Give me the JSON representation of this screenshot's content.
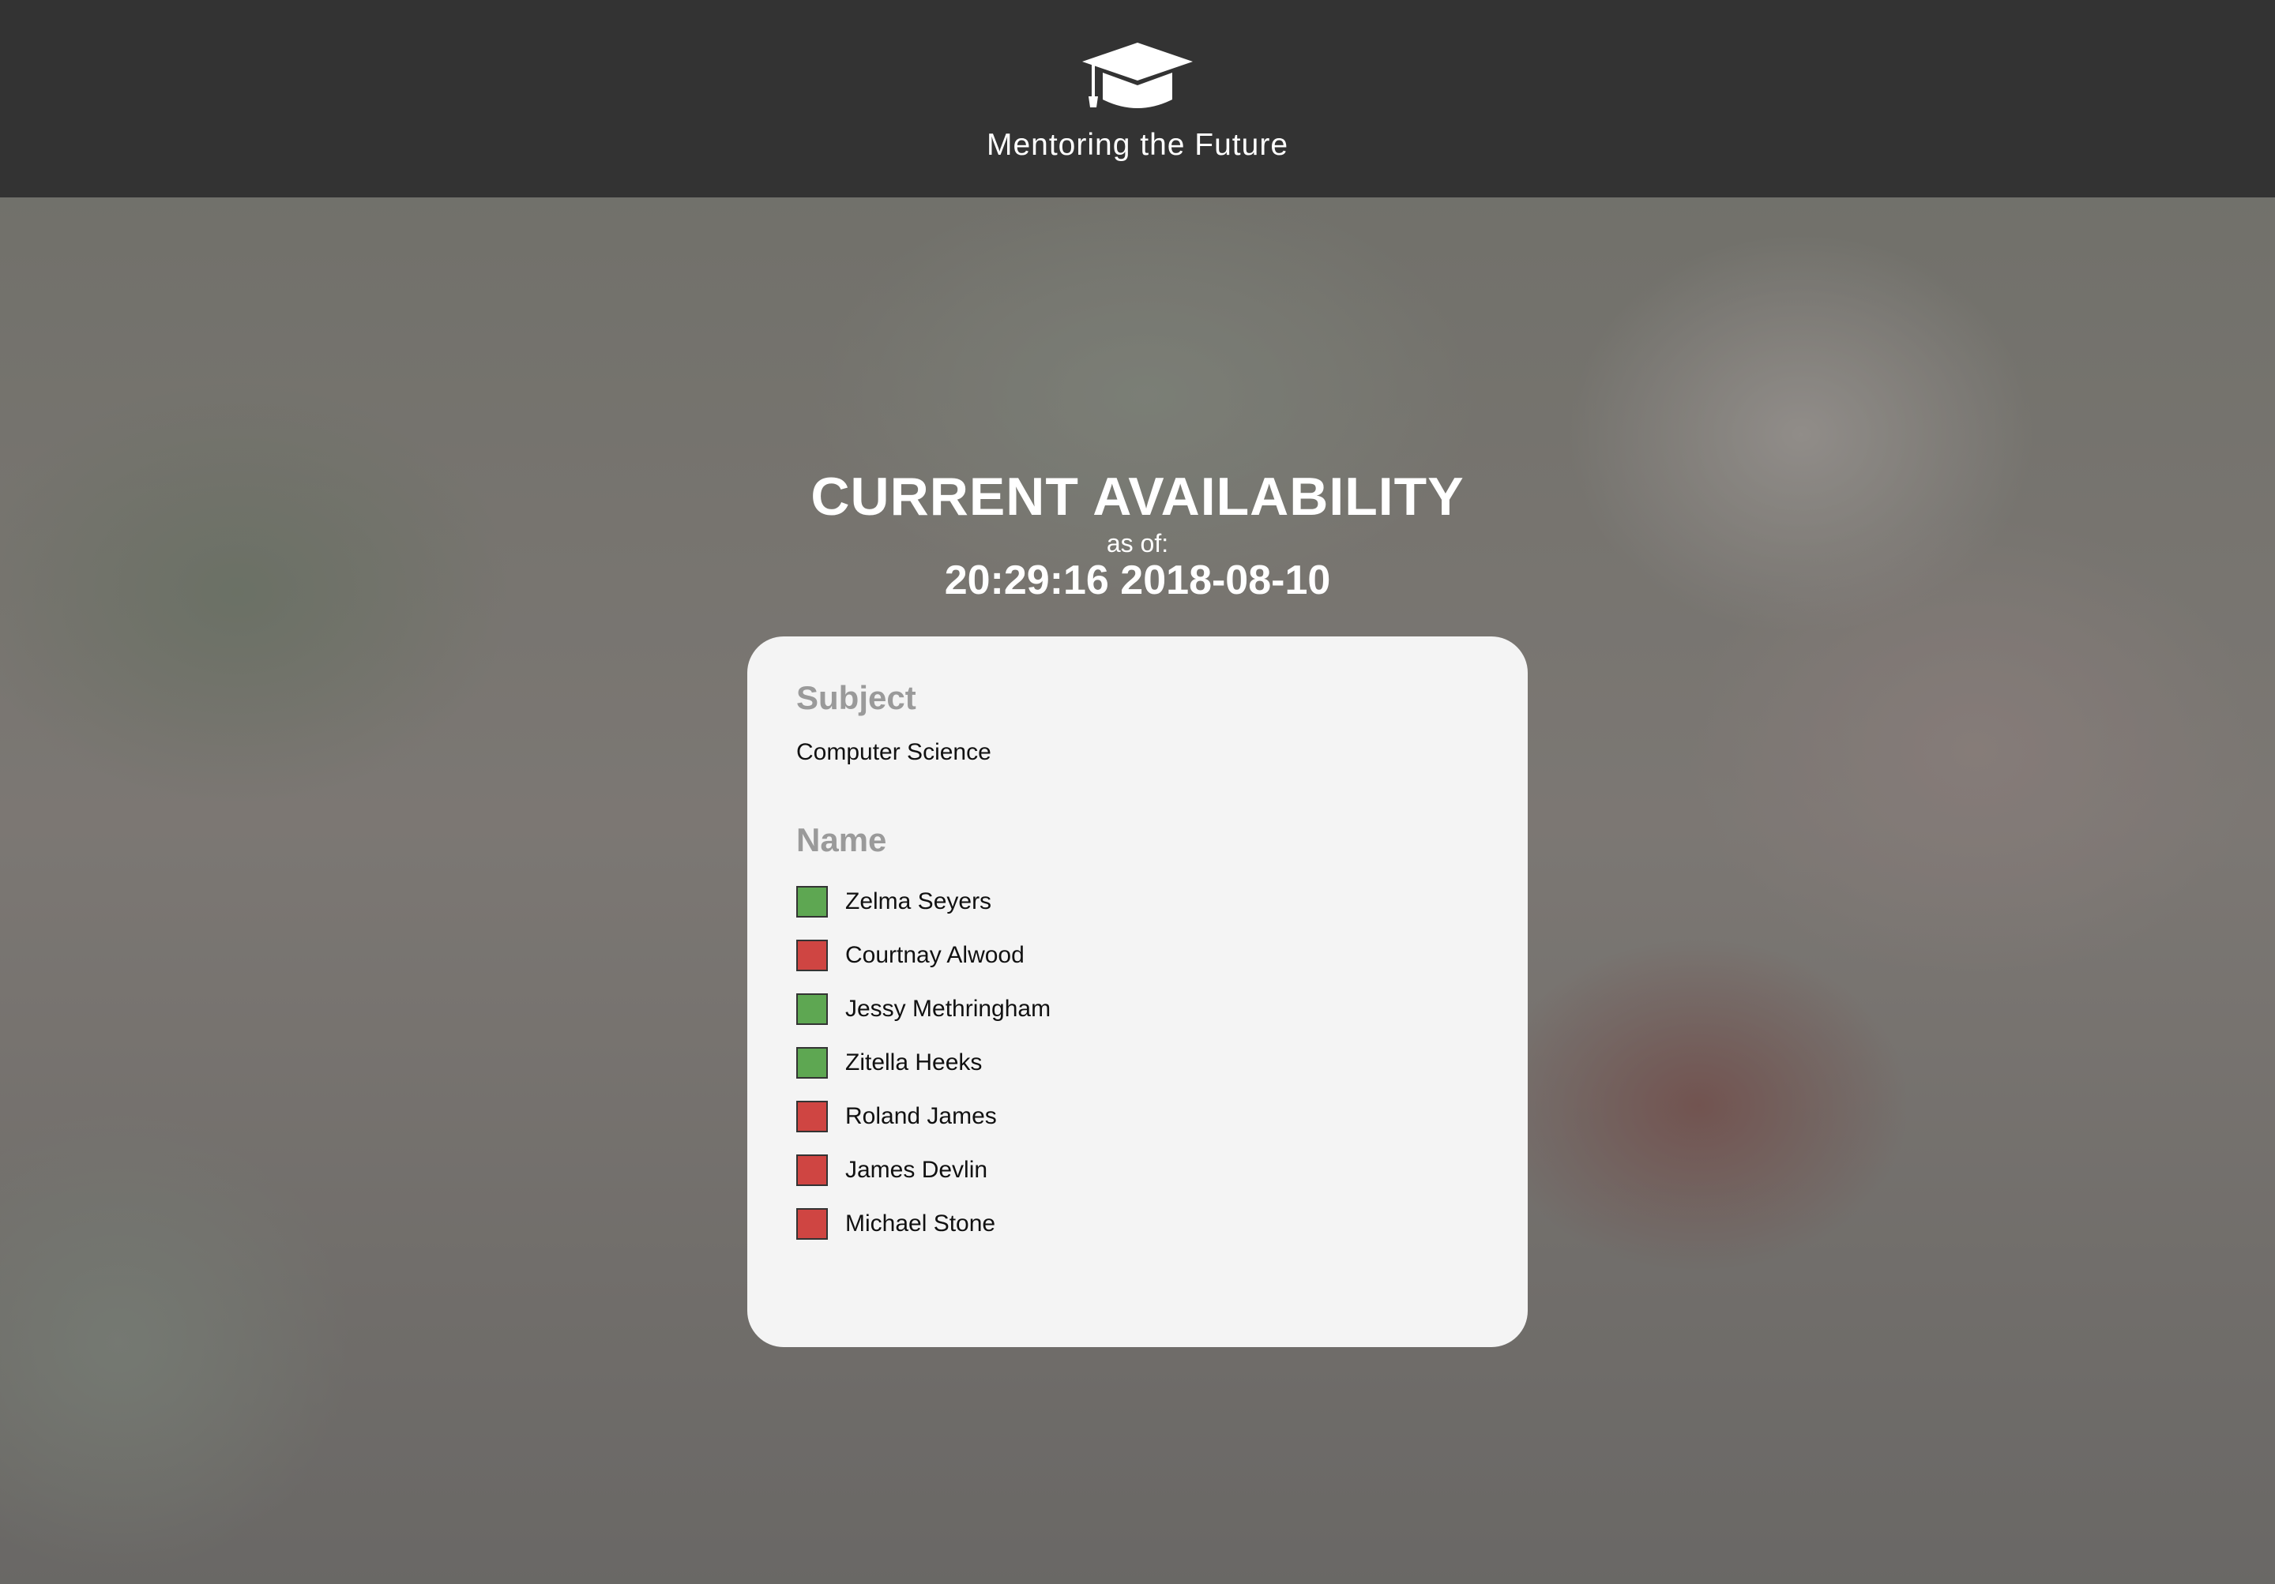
{
  "header": {
    "logo_icon": "graduation-cap-icon",
    "title": "Mentoring the Future"
  },
  "availability": {
    "heading": "CURRENT AVAILABILITY",
    "as_of_label": "as of:",
    "timestamp": "20:29:16 2018-08-10"
  },
  "card": {
    "subject_heading": "Subject",
    "subject_value": "Computer Science",
    "name_heading": "Name",
    "mentors": [
      {
        "name": "Zelma Seyers",
        "status": "available"
      },
      {
        "name": "Courtnay Alwood",
        "status": "unavailable"
      },
      {
        "name": "Jessy Methringham",
        "status": "available"
      },
      {
        "name": "Zitella Heeks",
        "status": "available"
      },
      {
        "name": "Roland James",
        "status": "unavailable"
      },
      {
        "name": "James Devlin",
        "status": "unavailable"
      },
      {
        "name": "Michael Stone",
        "status": "unavailable"
      }
    ]
  },
  "colors": {
    "header_bg": "#333333",
    "available": "#5ea752",
    "unavailable": "#cf4542",
    "card_bg": "#f4f4f4",
    "heading_gray": "#9a9a9a"
  }
}
